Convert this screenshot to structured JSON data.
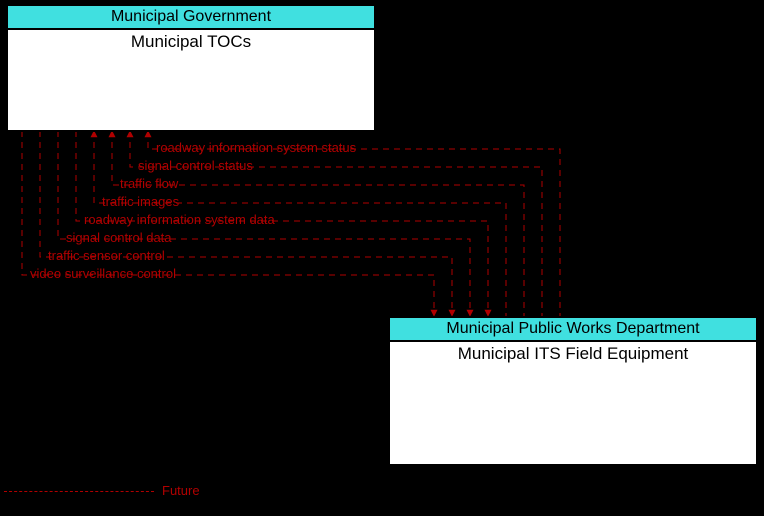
{
  "entities": {
    "top": {
      "header": "Municipal Government",
      "title": "Municipal TOCs"
    },
    "bottom": {
      "header": "Municipal Public Works Department",
      "title": "Municipal ITS Field Equipment"
    }
  },
  "flows": {
    "to_top": [
      "roadway information system status",
      "signal control status",
      "traffic flow",
      "traffic images"
    ],
    "to_bottom": [
      "roadway information system data",
      "signal control data",
      "traffic sensor control",
      "video surveillance control"
    ]
  },
  "legend": {
    "label": "Future"
  }
}
